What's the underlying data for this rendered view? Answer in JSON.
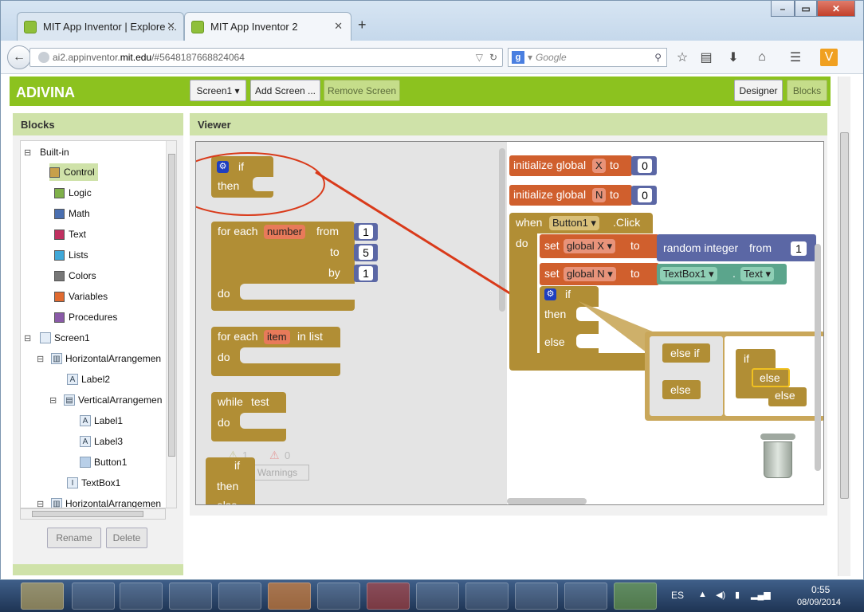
{
  "browser": {
    "tabs": [
      {
        "label": "MIT App Inventor | Explore ...",
        "close": "✕"
      },
      {
        "label": "MIT App Inventor 2",
        "close": "✕"
      }
    ],
    "new_tab": "+",
    "url_prefix": "ai2.appinventor.",
    "url_host": "mit.edu",
    "url_suffix": "/#5648187668824064",
    "search_placeholder": "Google",
    "window_buttons": [
      "–",
      "▭",
      "✕"
    ]
  },
  "app": {
    "name": "ADIVINA",
    "screen_select": "Screen1 ▾",
    "add_screen": "Add Screen ...",
    "remove_screen": "Remove Screen",
    "designer": "Designer",
    "blocks": "Blocks"
  },
  "blocks_panel": {
    "title": "Blocks",
    "builtin": "Built-in",
    "categories": [
      {
        "label": "Control",
        "color": "#c8a04a"
      },
      {
        "label": "Logic",
        "color": "#7fb04a"
      },
      {
        "label": "Math",
        "color": "#4a6fb0"
      },
      {
        "label": "Text",
        "color": "#c03060"
      },
      {
        "label": "Lists",
        "color": "#40a8d8"
      },
      {
        "label": "Colors",
        "color": "#777777"
      },
      {
        "label": "Variables",
        "color": "#e06a30"
      },
      {
        "label": "Procedures",
        "color": "#8a5aa8"
      }
    ],
    "components": [
      {
        "label": "Screen1"
      },
      {
        "label": "HorizontalArrangemen"
      },
      {
        "label": "Label2"
      },
      {
        "label": "VerticalArrangemen"
      },
      {
        "label": "Label1"
      },
      {
        "label": "Label3"
      },
      {
        "label": "Button1"
      },
      {
        "label": "TextBox1"
      },
      {
        "label": "HorizontalArrangemen"
      }
    ],
    "rename": "Rename",
    "delete": "Delete"
  },
  "viewer": {
    "title": "Viewer",
    "flyout": {
      "if": "if",
      "then": "then",
      "foreach_number": "for each",
      "number_var": "number",
      "from": "from",
      "to": "to",
      "by": "by",
      "do": "do",
      "from_val": "1",
      "to_val": "5",
      "by_val": "1",
      "foreach_item": "for each",
      "item_var": "item",
      "in_list": "in list",
      "while": "while",
      "test": "test",
      "warn_count": "1",
      "err_count": "0",
      "warnings": "Warnings",
      "else_partial": "else"
    },
    "workspace": {
      "init1": "initialize global",
      "init1_var": "X",
      "init_to": "to",
      "init1_val": "0",
      "init2": "initialize global",
      "init2_var": "N",
      "init2_val": "0",
      "when": "when",
      "component": "Button1 ▾",
      "event": ".Click",
      "do": "do",
      "set": "set",
      "global_x": "global X ▾",
      "set_to": "to",
      "random": "random integer",
      "from": "from",
      "random_from": "1",
      "global_n": "global N ▾",
      "textbox": "TextBox1 ▾",
      "dot": ".",
      "text_prop": "Text ▾",
      "if": "if",
      "then": "then",
      "else": "else",
      "mutator_elseif": "else if",
      "mutator_else": "else",
      "mini_if": "if",
      "mini_else1": "else",
      "mini_else2": "else"
    }
  },
  "taskbar": {
    "lang": "ES",
    "time": "0:55",
    "date": "08/09/2014"
  }
}
